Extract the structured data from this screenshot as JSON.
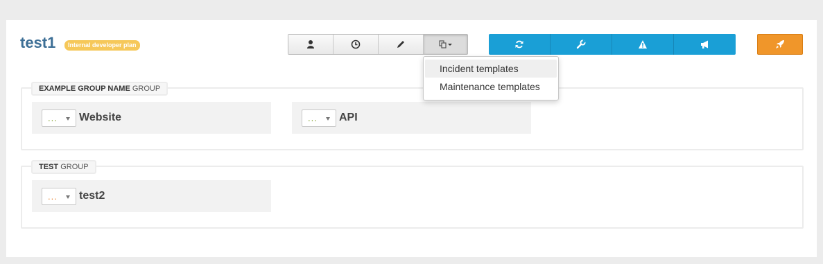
{
  "page": {
    "title": "test1",
    "plan_badge": "Internal developer plan"
  },
  "toolbar": {
    "gray_buttons": [
      {
        "icon": "user-icon"
      },
      {
        "icon": "clock-icon"
      },
      {
        "icon": "pencil-icon"
      },
      {
        "icon": "copy-dropdown-icon"
      }
    ],
    "blue_buttons": [
      {
        "icon": "refresh-icon"
      },
      {
        "icon": "wrench-icon"
      },
      {
        "icon": "warning-icon"
      },
      {
        "icon": "megaphone-icon"
      }
    ],
    "orange_button": {
      "icon": "rocket-icon"
    },
    "colors": {
      "blue": "#1a9fd6",
      "orange": "#f0962a",
      "title": "#3d6f96",
      "badge": "#f6c85a"
    }
  },
  "dropdown": {
    "items": [
      "Incident templates",
      "Maintenance templates"
    ]
  },
  "groups": [
    {
      "name": "EXAMPLE GROUP NAME",
      "suffix": "GROUP",
      "components": [
        {
          "name": "Website",
          "status_text": "...",
          "status_color": "#7a9a1e"
        },
        {
          "name": "API",
          "status_text": "...",
          "status_color": "#7a9a1e"
        }
      ]
    },
    {
      "name": "TEST",
      "suffix": "GROUP",
      "components": [
        {
          "name": "test2",
          "status_text": "...",
          "status_color": "#e87f2b"
        }
      ]
    }
  ]
}
